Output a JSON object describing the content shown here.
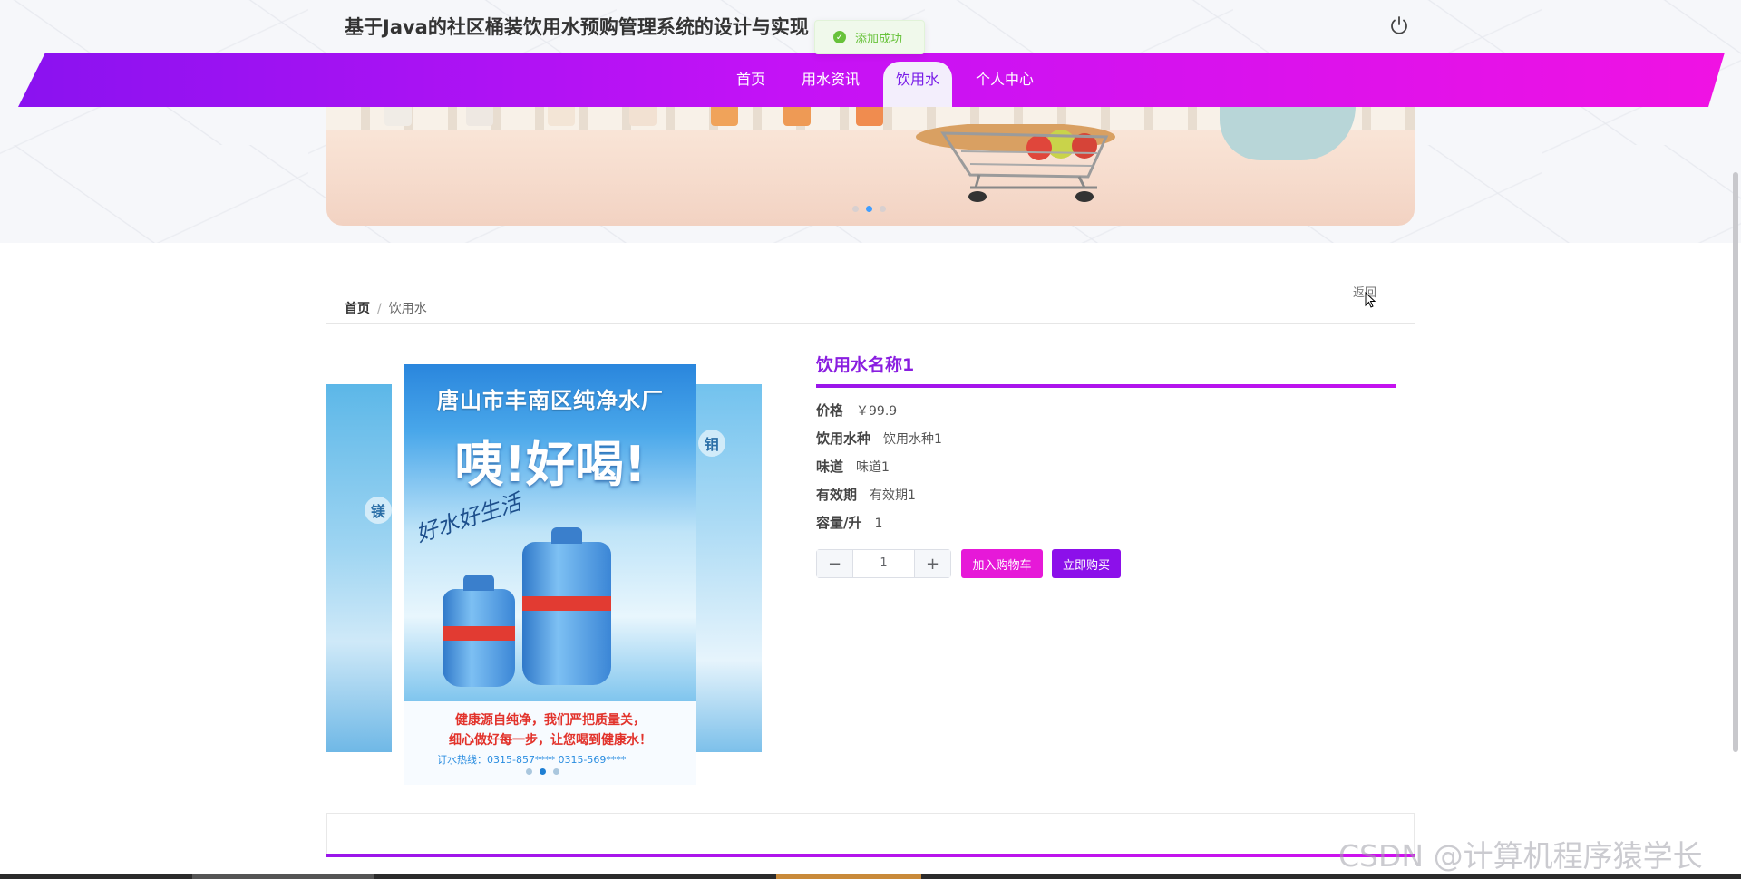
{
  "header": {
    "site_title": "基于Java的社区桶装饮用水预购管理系统的设计与实现",
    "logout_icon": "power-icon"
  },
  "toast": {
    "message": "添加成功",
    "color": "#67c23a"
  },
  "nav": {
    "items": [
      {
        "label": "首页"
      },
      {
        "label": "用水资讯"
      },
      {
        "label": "饮用水"
      },
      {
        "label": "个人中心"
      }
    ],
    "active": "饮用水"
  },
  "banner": {
    "carousel_count": 3,
    "active_index": 1
  },
  "breadcrumb": {
    "home": "首页",
    "separator": "/",
    "current": "饮用水"
  },
  "back_label": "返回",
  "poster": {
    "title": "唐山市丰南区纯净水厂",
    "slogan": "咦!好喝!",
    "script": "好水好生活",
    "line1": "健康源自纯净，我们严把质量关，",
    "line2": "细心做好每一步，让您喝到健康水！",
    "phone": "订水热线：0315-857****      0315-569****",
    "left_badge": "镁",
    "right_badge": "钼"
  },
  "product": {
    "name": "饮用水名称1",
    "attributes": [
      {
        "key": "价格",
        "value": "￥99.9"
      },
      {
        "key": "饮用水种",
        "value": "饮用水种1"
      },
      {
        "key": "味道",
        "value": "味道1"
      },
      {
        "key": "有效期",
        "value": "有效期1"
      },
      {
        "key": "容量/升",
        "value": "1"
      }
    ],
    "quantity": "1",
    "add_to_cart_label": "加入购物车",
    "buy_now_label": "立即购买"
  },
  "watermark": "CSDN @计算机程序猿学长",
  "colors": {
    "accent_purple": "#8c10ea",
    "accent_pink": "#e619d8"
  }
}
